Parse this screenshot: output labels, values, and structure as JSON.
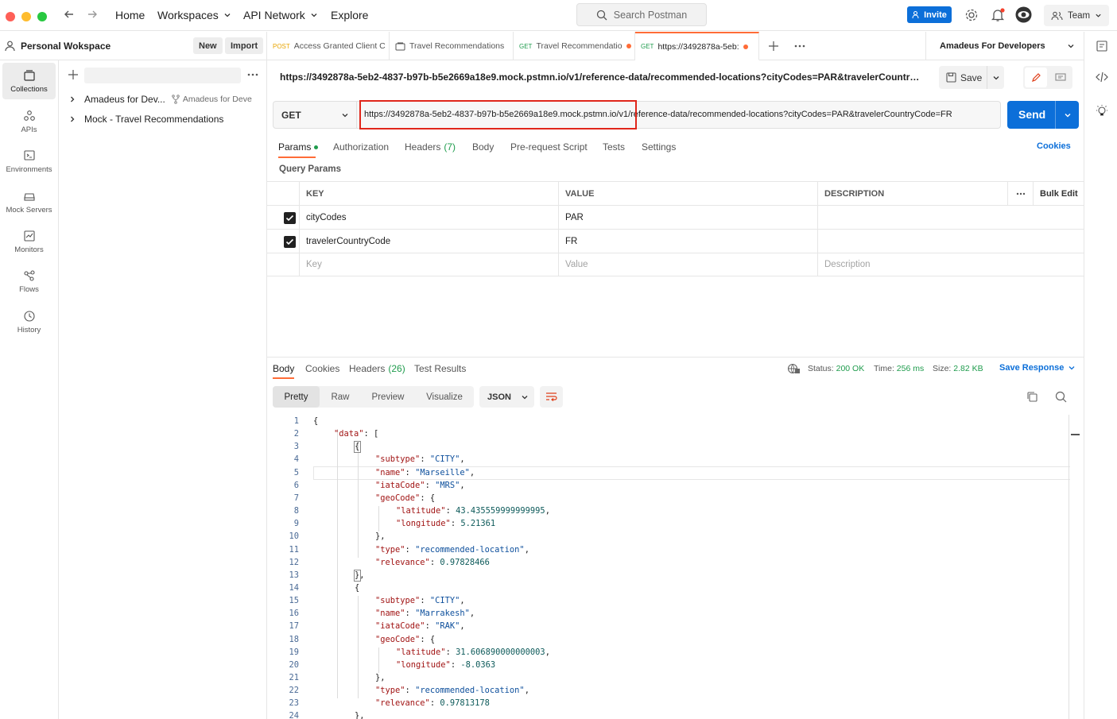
{
  "topbar": {
    "nav": {
      "home": "Home",
      "workspaces": "Workspaces",
      "api_network": "API Network",
      "explore": "Explore"
    },
    "search_placeholder": "Search Postman",
    "invite": "Invite",
    "team": "Team"
  },
  "workspace": {
    "name": "Personal Wokspace",
    "new": "New",
    "import": "Import"
  },
  "rail": [
    {
      "label": "Collections",
      "icon": "collections-icon",
      "active": true
    },
    {
      "label": "APIs",
      "icon": "apis-icon"
    },
    {
      "label": "Environments",
      "icon": "environments-icon"
    },
    {
      "label": "Mock Servers",
      "icon": "mock-servers-icon"
    },
    {
      "label": "Monitors",
      "icon": "monitors-icon"
    },
    {
      "label": "Flows",
      "icon": "flows-icon"
    },
    {
      "label": "History",
      "icon": "history-icon"
    }
  ],
  "collections": [
    {
      "name": "Amadeus for Dev...",
      "fork": "Amadeus for Deve"
    },
    {
      "name": "Mock - Travel Recommendations",
      "fork": ""
    }
  ],
  "tabs": [
    {
      "method": "POST",
      "method_color": "#e8a400",
      "title": "Access Granted Client C"
    },
    {
      "method": "",
      "title": "Travel Recommendations"
    },
    {
      "method": "GET",
      "method_color": "#1f9c4d",
      "title": "Travel Recommendatio",
      "dirty": true
    },
    {
      "method": "GET",
      "method_color": "#1f9c4d",
      "title": "https://3492878a-5eb:",
      "dirty": true,
      "active": true
    }
  ],
  "environment": "Amadeus For Developers",
  "request": {
    "title": "https://3492878a-5eb2-4837-b97b-b5e2669a18e9.mock.pstmn.io/v1/reference-data/recommended-locations?cityCodes=PAR&travelerCountryCode...",
    "save": "Save",
    "method": "GET",
    "url": "https://3492878a-5eb2-4837-b97b-b5e2669a18e9.mock.pstmn.io/v1/reference-data/recommended-locations?cityCodes=PAR&travelerCountryCode=FR",
    "send": "Send",
    "tabs": {
      "params": "Params",
      "authorization": "Authorization",
      "headers": "Headers",
      "headers_count": "(7)",
      "body": "Body",
      "prerequest": "Pre-request Script",
      "tests": "Tests",
      "settings": "Settings"
    },
    "cookies": "Cookies",
    "query_params_label": "Query Params",
    "table": {
      "headers": {
        "key": "KEY",
        "value": "VALUE",
        "description": "DESCRIPTION",
        "bulk_edit": "Bulk Edit"
      },
      "rows": [
        {
          "key": "cityCodes",
          "value": "PAR",
          "description": "",
          "checked": true
        },
        {
          "key": "travelerCountryCode",
          "value": "FR",
          "description": "",
          "checked": true
        }
      ],
      "placeholders": {
        "key": "Key",
        "value": "Value",
        "description": "Description"
      }
    }
  },
  "response": {
    "tabs": {
      "body": "Body",
      "cookies": "Cookies",
      "headers": "Headers",
      "headers_count": "(26)",
      "test_results": "Test Results"
    },
    "status_label": "Status:",
    "status": "200 OK",
    "time_label": "Time:",
    "time": "256 ms",
    "size_label": "Size:",
    "size": "2.82 KB",
    "save_response": "Save Response",
    "views": [
      "Pretty",
      "Raw",
      "Preview",
      "Visualize"
    ],
    "format": "JSON",
    "lines": [
      {
        "n": "1",
        "i": 0,
        "t": [
          [
            "p",
            "{"
          ]
        ]
      },
      {
        "n": "2",
        "i": 1,
        "t": [
          [
            "k",
            "\"data\""
          ],
          [
            "p",
            ": ["
          ]
        ]
      },
      {
        "n": "3",
        "i": 2,
        "t": [
          [
            "p",
            "{"
          ]
        ]
      },
      {
        "n": "4",
        "i": 3,
        "t": [
          [
            "k",
            "\"subtype\""
          ],
          [
            "p",
            ": "
          ],
          [
            "s",
            "\"CITY\""
          ],
          [
            "p",
            ","
          ]
        ]
      },
      {
        "n": "5",
        "i": 3,
        "t": [
          [
            "k",
            "\"name\""
          ],
          [
            "p",
            ": "
          ],
          [
            "s",
            "\"Marseille\""
          ],
          [
            "p",
            ","
          ]
        ]
      },
      {
        "n": "6",
        "i": 3,
        "t": [
          [
            "k",
            "\"iataCode\""
          ],
          [
            "p",
            ": "
          ],
          [
            "s",
            "\"MRS\""
          ],
          [
            "p",
            ","
          ]
        ]
      },
      {
        "n": "7",
        "i": 3,
        "t": [
          [
            "k",
            "\"geoCode\""
          ],
          [
            "p",
            ": {"
          ]
        ]
      },
      {
        "n": "8",
        "i": 4,
        "t": [
          [
            "k",
            "\"latitude\""
          ],
          [
            "p",
            ": "
          ],
          [
            "n",
            "43.435559999999995"
          ],
          [
            "p",
            ","
          ]
        ]
      },
      {
        "n": "9",
        "i": 4,
        "t": [
          [
            "k",
            "\"longitude\""
          ],
          [
            "p",
            ": "
          ],
          [
            "n",
            "5.21361"
          ]
        ]
      },
      {
        "n": "10",
        "i": 3,
        "t": [
          [
            "p",
            "},"
          ]
        ]
      },
      {
        "n": "11",
        "i": 3,
        "t": [
          [
            "k",
            "\"type\""
          ],
          [
            "p",
            ": "
          ],
          [
            "s",
            "\"recommended-location\""
          ],
          [
            "p",
            ","
          ]
        ]
      },
      {
        "n": "12",
        "i": 3,
        "t": [
          [
            "k",
            "\"relevance\""
          ],
          [
            "p",
            ": "
          ],
          [
            "n",
            "0.97828466"
          ]
        ]
      },
      {
        "n": "13",
        "i": 2,
        "t": [
          [
            "p",
            "},"
          ]
        ]
      },
      {
        "n": "14",
        "i": 2,
        "t": [
          [
            "p",
            "{"
          ]
        ]
      },
      {
        "n": "15",
        "i": 3,
        "t": [
          [
            "k",
            "\"subtype\""
          ],
          [
            "p",
            ": "
          ],
          [
            "s",
            "\"CITY\""
          ],
          [
            "p",
            ","
          ]
        ]
      },
      {
        "n": "16",
        "i": 3,
        "t": [
          [
            "k",
            "\"name\""
          ],
          [
            "p",
            ": "
          ],
          [
            "s",
            "\"Marrakesh\""
          ],
          [
            "p",
            ","
          ]
        ]
      },
      {
        "n": "17",
        "i": 3,
        "t": [
          [
            "k",
            "\"iataCode\""
          ],
          [
            "p",
            ": "
          ],
          [
            "s",
            "\"RAK\""
          ],
          [
            "p",
            ","
          ]
        ]
      },
      {
        "n": "18",
        "i": 3,
        "t": [
          [
            "k",
            "\"geoCode\""
          ],
          [
            "p",
            ": {"
          ]
        ]
      },
      {
        "n": "19",
        "i": 4,
        "t": [
          [
            "k",
            "\"latitude\""
          ],
          [
            "p",
            ": "
          ],
          [
            "n",
            "31.606890000000003"
          ],
          [
            "p",
            ","
          ]
        ]
      },
      {
        "n": "20",
        "i": 4,
        "t": [
          [
            "k",
            "\"longitude\""
          ],
          [
            "p",
            ": "
          ],
          [
            "n",
            "-8.0363"
          ]
        ]
      },
      {
        "n": "21",
        "i": 3,
        "t": [
          [
            "p",
            "},"
          ]
        ]
      },
      {
        "n": "22",
        "i": 3,
        "t": [
          [
            "k",
            "\"type\""
          ],
          [
            "p",
            ": "
          ],
          [
            "s",
            "\"recommended-location\""
          ],
          [
            "p",
            ","
          ]
        ]
      },
      {
        "n": "23",
        "i": 3,
        "t": [
          [
            "k",
            "\"relevance\""
          ],
          [
            "p",
            ": "
          ],
          [
            "n",
            "0.97813178"
          ]
        ]
      },
      {
        "n": "24",
        "i": 2,
        "t": [
          [
            "p",
            "},"
          ]
        ]
      }
    ]
  }
}
